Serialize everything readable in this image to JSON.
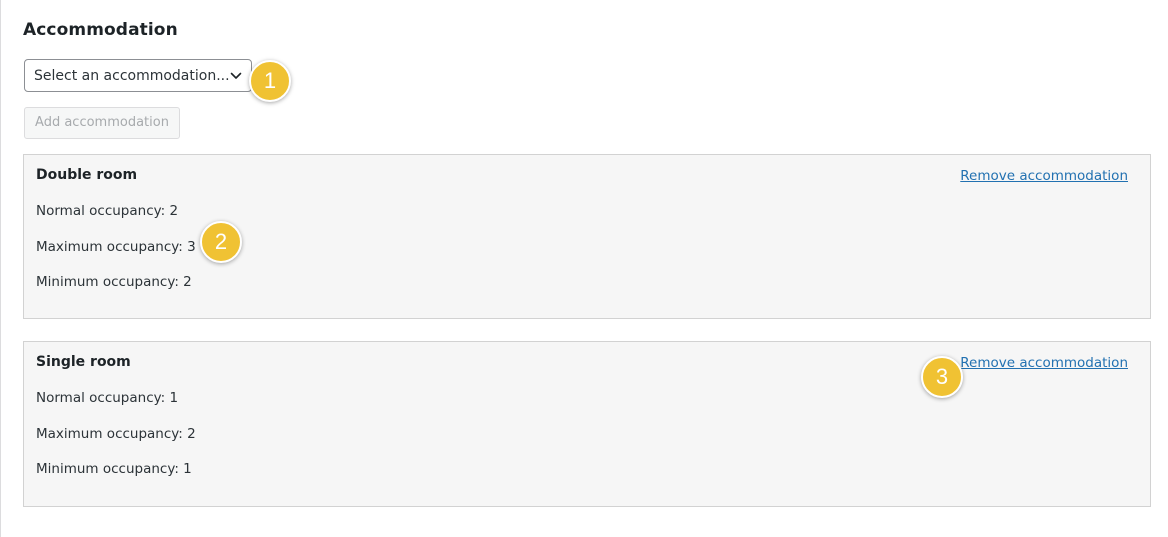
{
  "section": {
    "title": "Accommodation"
  },
  "select": {
    "value": "Select an accommodation...",
    "icon": "chevron-down-icon"
  },
  "add_button": {
    "label": "Add accommodation",
    "disabled": true
  },
  "rooms": [
    {
      "name": "Double room",
      "remove_label": "Remove accommodation",
      "normal": "Normal occupancy: 2",
      "maximum": "Maximum occupancy: 3",
      "minimum": "Minimum occupancy: 2"
    },
    {
      "name": "Single room",
      "remove_label": "Remove accommodation",
      "normal": "Normal occupancy: 1",
      "maximum": "Maximum occupancy: 2",
      "minimum": "Minimum occupancy: 1"
    }
  ],
  "badges": [
    "1",
    "2",
    "3"
  ],
  "colors": {
    "link": "#2271b1",
    "badge": "#f0c233",
    "card_bg": "#f6f6f6",
    "disabled_text": "#a7aaad"
  }
}
